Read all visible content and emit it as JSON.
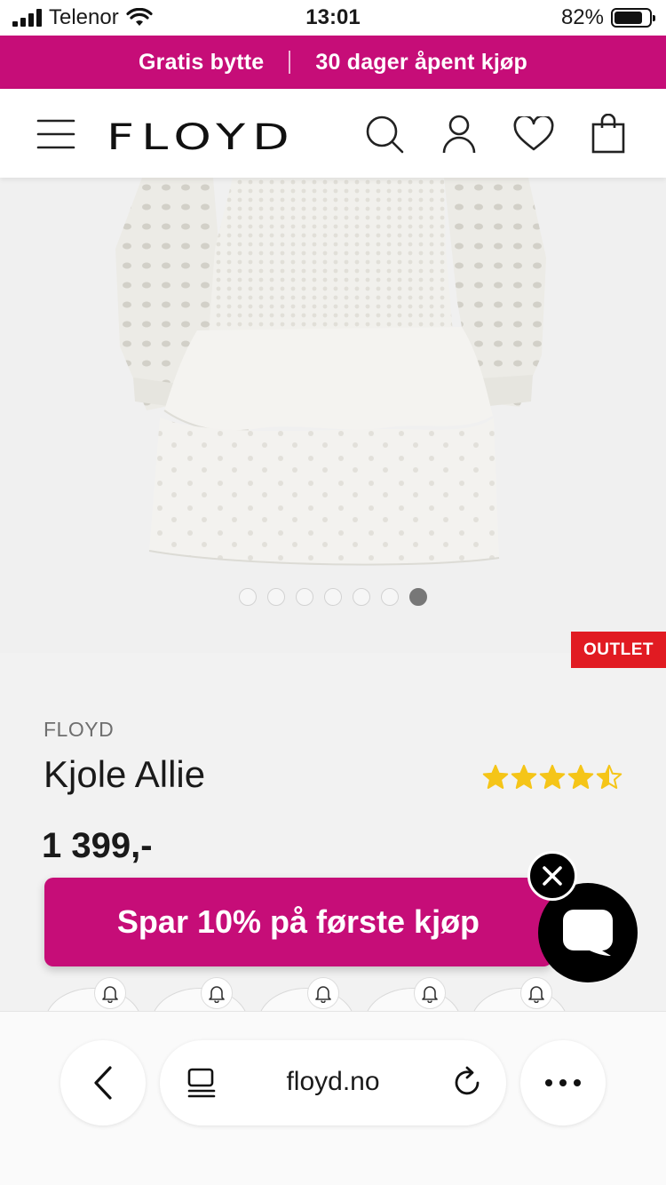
{
  "status_bar": {
    "carrier": "Telenor",
    "time": "13:01",
    "battery_percent": "82%",
    "battery_level": 0.82
  },
  "promo_bar": {
    "left_text": "Gratis bytte",
    "right_text": "30 dager åpent kjøp",
    "color": "#c60d78"
  },
  "header": {
    "logo": "FLOYD",
    "icons": [
      "menu-icon",
      "search-icon",
      "account-icon",
      "heart-icon",
      "bag-icon"
    ]
  },
  "gallery": {
    "total_images": 7,
    "active_index": 6
  },
  "product": {
    "badge": "OUTLET",
    "brand": "FLOYD",
    "name": "Kjole Allie",
    "rating": 4.5,
    "rating_max": 5,
    "price": "1 399,-"
  },
  "popup": {
    "text": "Spar 10% på første kjøp"
  },
  "browser": {
    "url": "floyd.no",
    "icons": [
      "back-icon",
      "reader-icon",
      "reload-icon",
      "more-icon"
    ]
  },
  "colors": {
    "brand_pink": "#c60d78",
    "outlet_red": "#e11b22",
    "star_yellow": "#f5c518"
  }
}
